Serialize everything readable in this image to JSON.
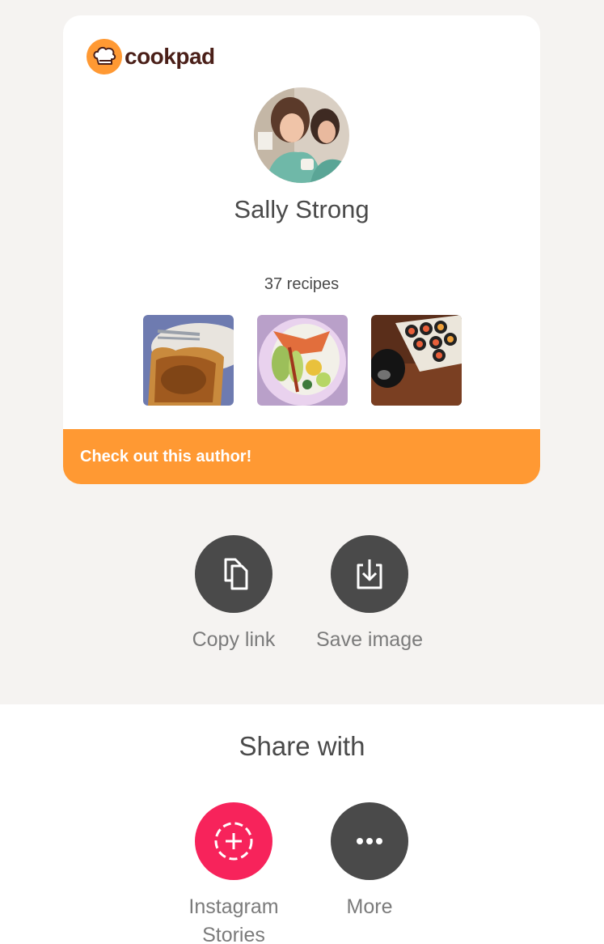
{
  "card": {
    "brand_name": "cookpad",
    "author_name": "Sally Strong",
    "recipe_count": "37 recipes",
    "footer_text": "Check out this author!",
    "accent_color": "#ff9933"
  },
  "actions": {
    "copy_label": "Copy link",
    "save_label": "Save image"
  },
  "share": {
    "title": "Share with",
    "instagram_label_line1": "Instagram",
    "instagram_label_line2": "Stories",
    "more_label": "More",
    "instagram_color": "#f7235b"
  },
  "icons": [
    "chef-hat-icon",
    "copy-icon",
    "download-icon",
    "instagram-add-icon",
    "more-dots-icon"
  ]
}
